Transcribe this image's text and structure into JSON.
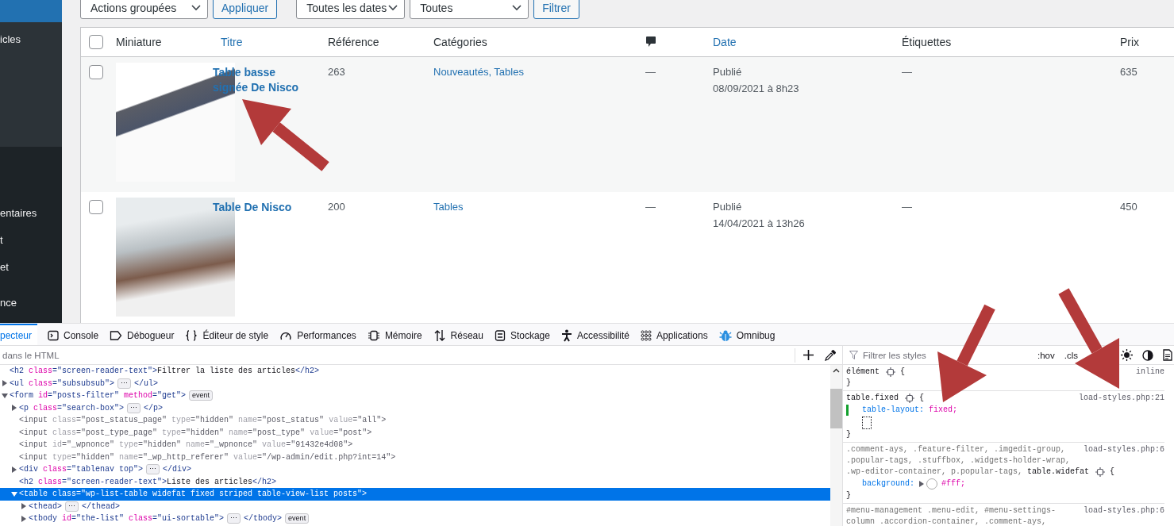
{
  "sidebar": {
    "submenu_items": [
      {
        "label": "icles"
      }
    ],
    "items": [
      {
        "label": "entaires"
      },
      {
        "label": "t"
      },
      {
        "label": "et"
      },
      {
        "label": "nce"
      }
    ]
  },
  "bulk_actions": {
    "select": "Actions groupées",
    "apply": "Appliquer"
  },
  "filters": {
    "dates": "Toutes les dates",
    "categories": "Toutes",
    "button": "Filtrer"
  },
  "table": {
    "select_all_checked": false,
    "columns": [
      {
        "label": "Miniature",
        "sortable": false
      },
      {
        "label": "Titre",
        "sortable": true
      },
      {
        "label": "Référence",
        "sortable": false
      },
      {
        "label": "Catégories",
        "sortable": false
      },
      {
        "kind": "comments"
      },
      {
        "label": "Date",
        "sortable": true
      },
      {
        "label": "Étiquettes",
        "sortable": false
      },
      {
        "label": "Prix",
        "sortable": false
      }
    ],
    "rows": [
      {
        "checked": false,
        "title": "Table basse signée De Nisco",
        "reference": "263",
        "categories": "Nouveautés, Tables",
        "comments": "—",
        "status": "Publié",
        "date": "08/09/2021 à 8h23",
        "tags": "—",
        "price": "635"
      },
      {
        "checked": false,
        "title": "Table De Nisco",
        "reference": "200",
        "categories": "Tables",
        "comments": "—",
        "status": "Publié",
        "date": "14/04/2021 à 13h26",
        "tags": "—",
        "price": "450"
      }
    ]
  },
  "devtools": {
    "tabs": [
      {
        "label": "pecteur",
        "selected": true
      },
      {
        "label": "Console",
        "selected": false
      },
      {
        "label": "Débogueur",
        "selected": false
      },
      {
        "label": "Éditeur de style",
        "selected": false
      },
      {
        "label": "Performances",
        "selected": false
      },
      {
        "label": "Mémoire",
        "selected": false
      },
      {
        "label": "Réseau",
        "selected": false
      },
      {
        "label": "Stockage",
        "selected": false
      },
      {
        "label": "Accessibilité",
        "selected": false
      },
      {
        "label": "Applications",
        "selected": false
      },
      {
        "label": "Omnibug",
        "selected": false
      }
    ],
    "html_search": {
      "placeholder": "dans le HTML"
    },
    "html_tree": [
      {
        "kind": "leaf",
        "selected": false,
        "dimmed": false,
        "segments": [
          {
            "kind": "tag",
            "text": "<h2"
          },
          {
            "kind": "attr",
            "text": " class"
          },
          {
            "kind": "value",
            "text": "=\"screen-reader-text\""
          },
          {
            "kind": "tag",
            "text": ">"
          },
          {
            "kind": "text",
            "text": "Filtrer la liste des articles"
          },
          {
            "kind": "tag",
            "text": "</h2>"
          }
        ]
      },
      {
        "kind": "branch",
        "expanded": false,
        "selected": false,
        "dimmed": false,
        "segments": [
          {
            "kind": "tag",
            "text": "<ul"
          },
          {
            "kind": "attr",
            "text": " class"
          },
          {
            "kind": "value",
            "text": "=\"subsubsub\""
          },
          {
            "kind": "tag",
            "text": ">"
          },
          {
            "kind": "more",
            "text": "⋯"
          },
          {
            "kind": "tag",
            "text": "</ul>"
          }
        ]
      },
      {
        "kind": "branch",
        "expanded": true,
        "selected": false,
        "dimmed": false,
        "segments": [
          {
            "kind": "tag",
            "text": "<form"
          },
          {
            "kind": "attr",
            "text": " id"
          },
          {
            "kind": "value",
            "text": "=\"posts-filter\""
          },
          {
            "kind": "attr",
            "text": " method"
          },
          {
            "kind": "value",
            "text": "=\"get\""
          },
          {
            "kind": "tag",
            "text": ">"
          },
          {
            "kind": "event",
            "text": "event"
          }
        ],
        "children": [
          {
            "kind": "branch",
            "expanded": false,
            "selected": false,
            "dimmed": false,
            "segments": [
              {
                "kind": "tag",
                "text": "<p"
              },
              {
                "kind": "attr",
                "text": " class"
              },
              {
                "kind": "value",
                "text": "=\"search-box\""
              },
              {
                "kind": "tag",
                "text": ">"
              },
              {
                "kind": "more",
                "text": "⋯"
              },
              {
                "kind": "tag",
                "text": "</p>"
              }
            ]
          },
          {
            "kind": "leaf",
            "selected": false,
            "dimmed": true,
            "segments": [
              {
                "kind": "tag",
                "text": "<input"
              },
              {
                "kind": "attr",
                "text": " class"
              },
              {
                "kind": "value",
                "text": "=\"post_status_page\""
              },
              {
                "kind": "attr",
                "text": " type"
              },
              {
                "kind": "value",
                "text": "=\"hidden\""
              },
              {
                "kind": "attr",
                "text": " name"
              },
              {
                "kind": "value",
                "text": "=\"post_status\""
              },
              {
                "kind": "attr",
                "text": " value"
              },
              {
                "kind": "value",
                "text": "=\"all\""
              },
              {
                "kind": "tag",
                "text": ">"
              }
            ]
          },
          {
            "kind": "leaf",
            "selected": false,
            "dimmed": true,
            "segments": [
              {
                "kind": "tag",
                "text": "<input"
              },
              {
                "kind": "attr",
                "text": " class"
              },
              {
                "kind": "value",
                "text": "=\"post_type_page\""
              },
              {
                "kind": "attr",
                "text": " type"
              },
              {
                "kind": "value",
                "text": "=\"hidden\""
              },
              {
                "kind": "attr",
                "text": " name"
              },
              {
                "kind": "value",
                "text": "=\"post_type\""
              },
              {
                "kind": "attr",
                "text": " value"
              },
              {
                "kind": "value",
                "text": "=\"post\""
              },
              {
                "kind": "tag",
                "text": ">"
              }
            ]
          },
          {
            "kind": "leaf",
            "selected": false,
            "dimmed": true,
            "segments": [
              {
                "kind": "tag",
                "text": "<input"
              },
              {
                "kind": "attr",
                "text": " id"
              },
              {
                "kind": "value",
                "text": "=\"_wpnonce\""
              },
              {
                "kind": "attr",
                "text": " type"
              },
              {
                "kind": "value",
                "text": "=\"hidden\""
              },
              {
                "kind": "attr",
                "text": " name"
              },
              {
                "kind": "value",
                "text": "=\"_wpnonce\""
              },
              {
                "kind": "attr",
                "text": " value"
              },
              {
                "kind": "value",
                "text": "=\"91432e4d08\""
              },
              {
                "kind": "tag",
                "text": ">"
              }
            ]
          },
          {
            "kind": "leaf",
            "selected": false,
            "dimmed": true,
            "segments": [
              {
                "kind": "tag",
                "text": "<input"
              },
              {
                "kind": "attr",
                "text": " type"
              },
              {
                "kind": "value",
                "text": "=\"hidden\""
              },
              {
                "kind": "attr",
                "text": " name"
              },
              {
                "kind": "value",
                "text": "=\"_wp_http_referer\""
              },
              {
                "kind": "attr",
                "text": " value"
              },
              {
                "kind": "value",
                "text": "=\"/wp-admin/edit.php?int=14\""
              },
              {
                "kind": "tag",
                "text": ">"
              }
            ]
          },
          {
            "kind": "branch",
            "expanded": false,
            "selected": false,
            "dimmed": false,
            "segments": [
              {
                "kind": "tag",
                "text": "<div"
              },
              {
                "kind": "attr",
                "text": " class"
              },
              {
                "kind": "value",
                "text": "=\"tablenav top\""
              },
              {
                "kind": "tag",
                "text": ">"
              },
              {
                "kind": "more",
                "text": "⋯"
              },
              {
                "kind": "tag",
                "text": "</div>"
              }
            ]
          },
          {
            "kind": "leaf",
            "selected": false,
            "dimmed": false,
            "segments": [
              {
                "kind": "tag",
                "text": "<h2"
              },
              {
                "kind": "attr",
                "text": " class"
              },
              {
                "kind": "value",
                "text": "=\"screen-reader-text\""
              },
              {
                "kind": "tag",
                "text": ">"
              },
              {
                "kind": "text",
                "text": "Liste des articles"
              },
              {
                "kind": "tag",
                "text": "</h2>"
              }
            ]
          },
          {
            "kind": "branch",
            "expanded": true,
            "selected": true,
            "dimmed": false,
            "segments": [
              {
                "kind": "tag",
                "text": "<table"
              },
              {
                "kind": "attr",
                "text": " class"
              },
              {
                "kind": "value",
                "text": "=\"wp-list-table widefat fixed striped table-view-list posts\""
              },
              {
                "kind": "tag",
                "text": ">"
              }
            ],
            "children": [
              {
                "kind": "branch",
                "expanded": false,
                "selected": false,
                "dimmed": false,
                "segments": [
                  {
                    "kind": "tag",
                    "text": "<thead"
                  },
                  {
                    "kind": "tag",
                    "text": ">"
                  },
                  {
                    "kind": "more",
                    "text": "⋯"
                  },
                  {
                    "kind": "tag",
                    "text": "</thead>"
                  }
                ]
              },
              {
                "kind": "branch",
                "expanded": false,
                "selected": false,
                "dimmed": false,
                "segments": [
                  {
                    "kind": "tag",
                    "text": "<tbody"
                  },
                  {
                    "kind": "attr",
                    "text": " id"
                  },
                  {
                    "kind": "value",
                    "text": "=\"the-list\""
                  },
                  {
                    "kind": "attr",
                    "text": " class"
                  },
                  {
                    "kind": "value",
                    "text": "=\"ui-sortable\""
                  },
                  {
                    "kind": "tag",
                    "text": ">"
                  },
                  {
                    "kind": "more",
                    "text": "⋯"
                  },
                  {
                    "kind": "tag",
                    "text": "</tbody>"
                  },
                  {
                    "kind": "event",
                    "text": "event"
                  }
                ]
              }
            ]
          }
        ]
      }
    ],
    "style_filter": {
      "placeholder": "Filtrer les styles"
    },
    "style_toggles": [
      ":hov",
      ".cls"
    ],
    "rules": [
      {
        "selector_lines": [
          [
            {
              "text": "élément",
              "matched": true
            }
          ]
        ],
        "open": "{",
        "close": "}",
        "source": "inline"
      },
      {
        "selector_lines": [
          [
            {
              "text": "table.fixed",
              "matched": true
            }
          ]
        ],
        "open": "{",
        "close": "}",
        "source": "load-styles.php:21",
        "declarations": [
          {
            "property": "table-layout:",
            "value": "fixed;",
            "changed": true,
            "swatch": false
          }
        ],
        "new_property_editor": true
      },
      {
        "selector_lines": [
          [
            {
              "text": ".comment-ays, .feature-filter, .imgedit-group,",
              "matched": false
            }
          ],
          [
            {
              "text": ".popular-tags, .stuffbox, .widgets-holder-wrap,",
              "matched": false
            }
          ],
          [
            {
              "text": ".wp-editor-container, p.popular-tags,",
              "matched": false
            },
            {
              "text": "table.widefat",
              "matched": true
            }
          ]
        ],
        "open": "{",
        "close": "}",
        "source": "load-styles.php:6",
        "declarations": [
          {
            "property": "background:",
            "value": "#fff;",
            "changed": false,
            "swatch": true
          }
        ]
      },
      {
        "selector_lines": [
          [
            {
              "text": "#menu-management .menu-edit, #menu-settings-",
              "matched": false
            }
          ],
          [
            {
              "text": "column .accordion-container, .comment-ays,",
              "matched": false
            }
          ]
        ],
        "source": "load-styles.php:6"
      }
    ]
  }
}
